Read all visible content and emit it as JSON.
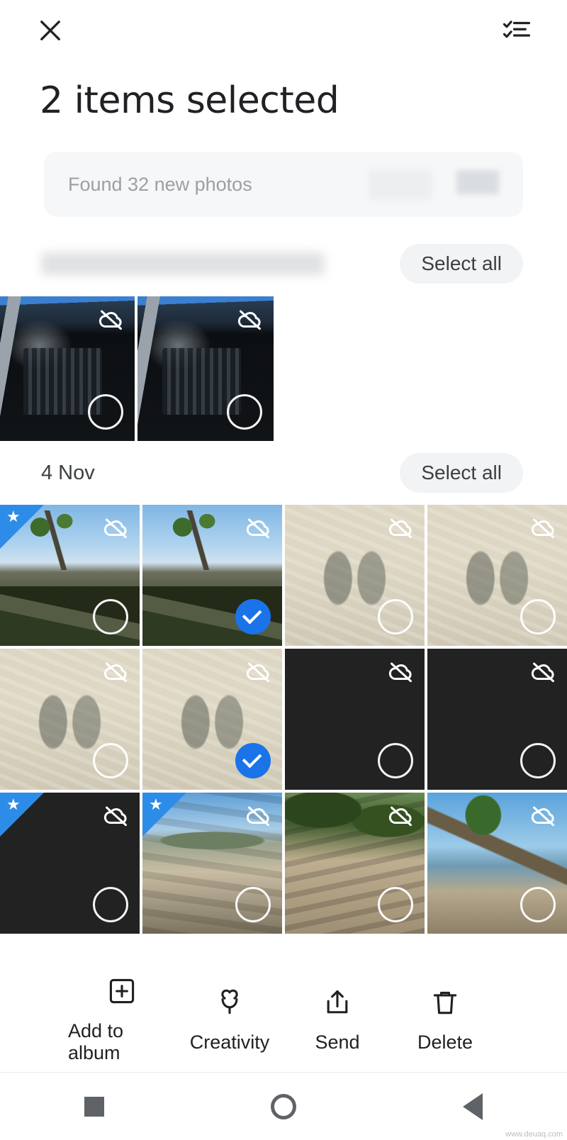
{
  "topbar": {
    "close_icon": "close-icon",
    "select_mode_icon": "checklist-icon"
  },
  "header": {
    "title": "2 items selected"
  },
  "suggestion_card": {
    "text": "Found 32 new photos"
  },
  "sections": [
    {
      "label": "",
      "label_blurred": true,
      "select_all_label": "Select all",
      "photos": [
        {
          "alt": "computer-cable-photo",
          "starred": false,
          "selected": false,
          "cloud_off": true,
          "style": "ph-cable"
        },
        {
          "alt": "computer-cable-photo",
          "starred": false,
          "selected": false,
          "cloud_off": true,
          "style": "ph-cable"
        }
      ]
    },
    {
      "label": "4 Nov",
      "label_blurred": false,
      "select_all_label": "Select all",
      "photos": [
        {
          "alt": "beach-tree-photo",
          "starred": true,
          "selected": false,
          "cloud_off": true,
          "style": "ph-tree"
        },
        {
          "alt": "beach-tree-photo",
          "starred": false,
          "selected": true,
          "cloud_off": true,
          "style": "ph-tree"
        },
        {
          "alt": "two-shadows-water-photo",
          "starred": false,
          "selected": false,
          "cloud_off": true,
          "style": "ph-water"
        },
        {
          "alt": "two-shadows-water-photo",
          "starred": false,
          "selected": false,
          "cloud_off": true,
          "style": "ph-water"
        },
        {
          "alt": "two-shadows-water-photo",
          "starred": false,
          "selected": false,
          "cloud_off": true,
          "style": "ph-water"
        },
        {
          "alt": "two-shadows-water-photo",
          "starred": false,
          "selected": true,
          "cloud_off": true,
          "style": "ph-water"
        },
        {
          "alt": "single-shadow-water-photo",
          "starred": false,
          "selected": false,
          "cloud_off": true,
          "style": "ph-water1"
        },
        {
          "alt": "single-shadow-water-photo",
          "starred": false,
          "selected": false,
          "cloud_off": true,
          "style": "ph-water1"
        },
        {
          "alt": "single-shadow-water-photo",
          "starred": true,
          "selected": false,
          "cloud_off": true,
          "style": "ph-water1"
        },
        {
          "alt": "sandy-beach-photo",
          "starred": true,
          "selected": false,
          "cloud_off": true,
          "style": "ph-beach"
        },
        {
          "alt": "beach-shade-tree-photo",
          "starred": false,
          "selected": false,
          "cloud_off": true,
          "style": "ph-shade"
        },
        {
          "alt": "leaning-tree-beach-photo",
          "starred": false,
          "selected": false,
          "cloud_off": true,
          "style": "ph-lean"
        }
      ]
    }
  ],
  "actions": [
    {
      "label": "Add to album",
      "icon": "add-to-album-icon"
    },
    {
      "label": "Creativity",
      "icon": "creativity-icon"
    },
    {
      "label": "Send",
      "icon": "share-icon"
    },
    {
      "label": "Delete",
      "icon": "trash-icon"
    }
  ],
  "navbar": {
    "recents": "square-icon",
    "home": "circle-icon",
    "back": "triangle-back-icon"
  },
  "watermark": "www.deuaq.com",
  "colors": {
    "accent": "#1a73e8",
    "ribbon": "#2d8ce8",
    "chip_bg": "#f1f3f4",
    "text": "#202124"
  }
}
